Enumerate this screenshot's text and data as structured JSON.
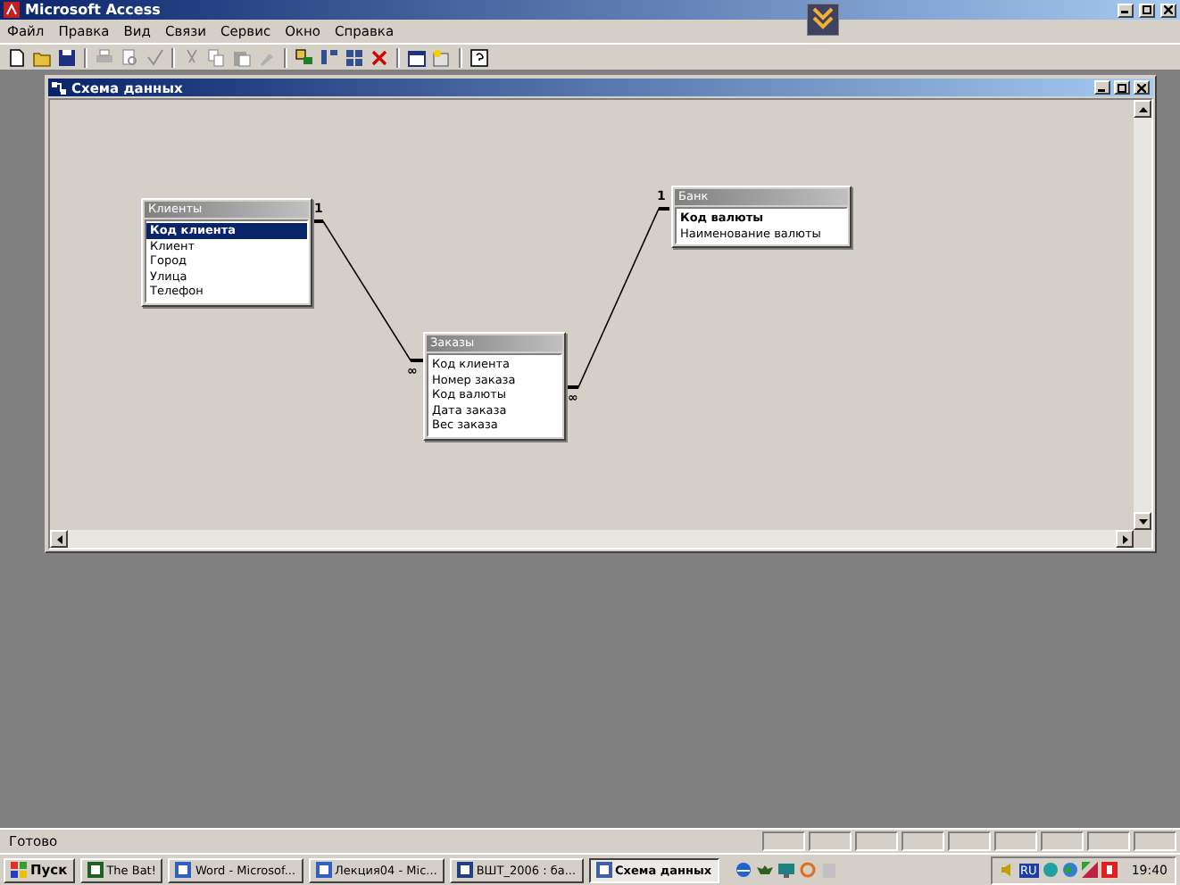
{
  "window": {
    "title": "Microsoft Access"
  },
  "menu": [
    "Файл",
    "Правка",
    "Вид",
    "Связи",
    "Сервис",
    "Окно",
    "Справка"
  ],
  "child_window": {
    "title": "Схема данных"
  },
  "tables": [
    {
      "title": "Клиенты",
      "fields": [
        {
          "name": "Код клиента",
          "key": true,
          "selected": true
        },
        {
          "name": "Клиент",
          "key": false,
          "selected": false
        },
        {
          "name": "Город",
          "key": false,
          "selected": false
        },
        {
          "name": "Улица",
          "key": false,
          "selected": false
        },
        {
          "name": "Телефон",
          "key": false,
          "selected": false
        }
      ]
    },
    {
      "title": "Заказы",
      "fields": [
        {
          "name": "Код клиента",
          "key": false,
          "selected": false
        },
        {
          "name": "Номер заказа",
          "key": false,
          "selected": false
        },
        {
          "name": "Код валюты",
          "key": false,
          "selected": false
        },
        {
          "name": "Дата заказа",
          "key": false,
          "selected": false
        },
        {
          "name": "Вес заказа",
          "key": false,
          "selected": false
        }
      ]
    },
    {
      "title": "Банк",
      "fields": [
        {
          "name": "Код валюты",
          "key": true,
          "selected": false
        },
        {
          "name": "Наименование валюты",
          "key": false,
          "selected": false
        }
      ]
    }
  ],
  "relationships": [
    {
      "one_label": "1",
      "many_label": "∞"
    },
    {
      "one_label": "1",
      "many_label": "∞"
    }
  ],
  "status_bar": {
    "text": "Готово"
  },
  "taskbar": {
    "start": "Пуск",
    "tasks": [
      {
        "label": "The Bat!",
        "selected": false
      },
      {
        "label": "Word - Microsof...",
        "selected": false
      },
      {
        "label": "Лекция04 - Mic...",
        "selected": false
      },
      {
        "label": "ВШТ_2006 : ба...",
        "selected": false
      },
      {
        "label": "Схема данных",
        "selected": true
      }
    ],
    "language": "RU",
    "clock": "19:40"
  }
}
